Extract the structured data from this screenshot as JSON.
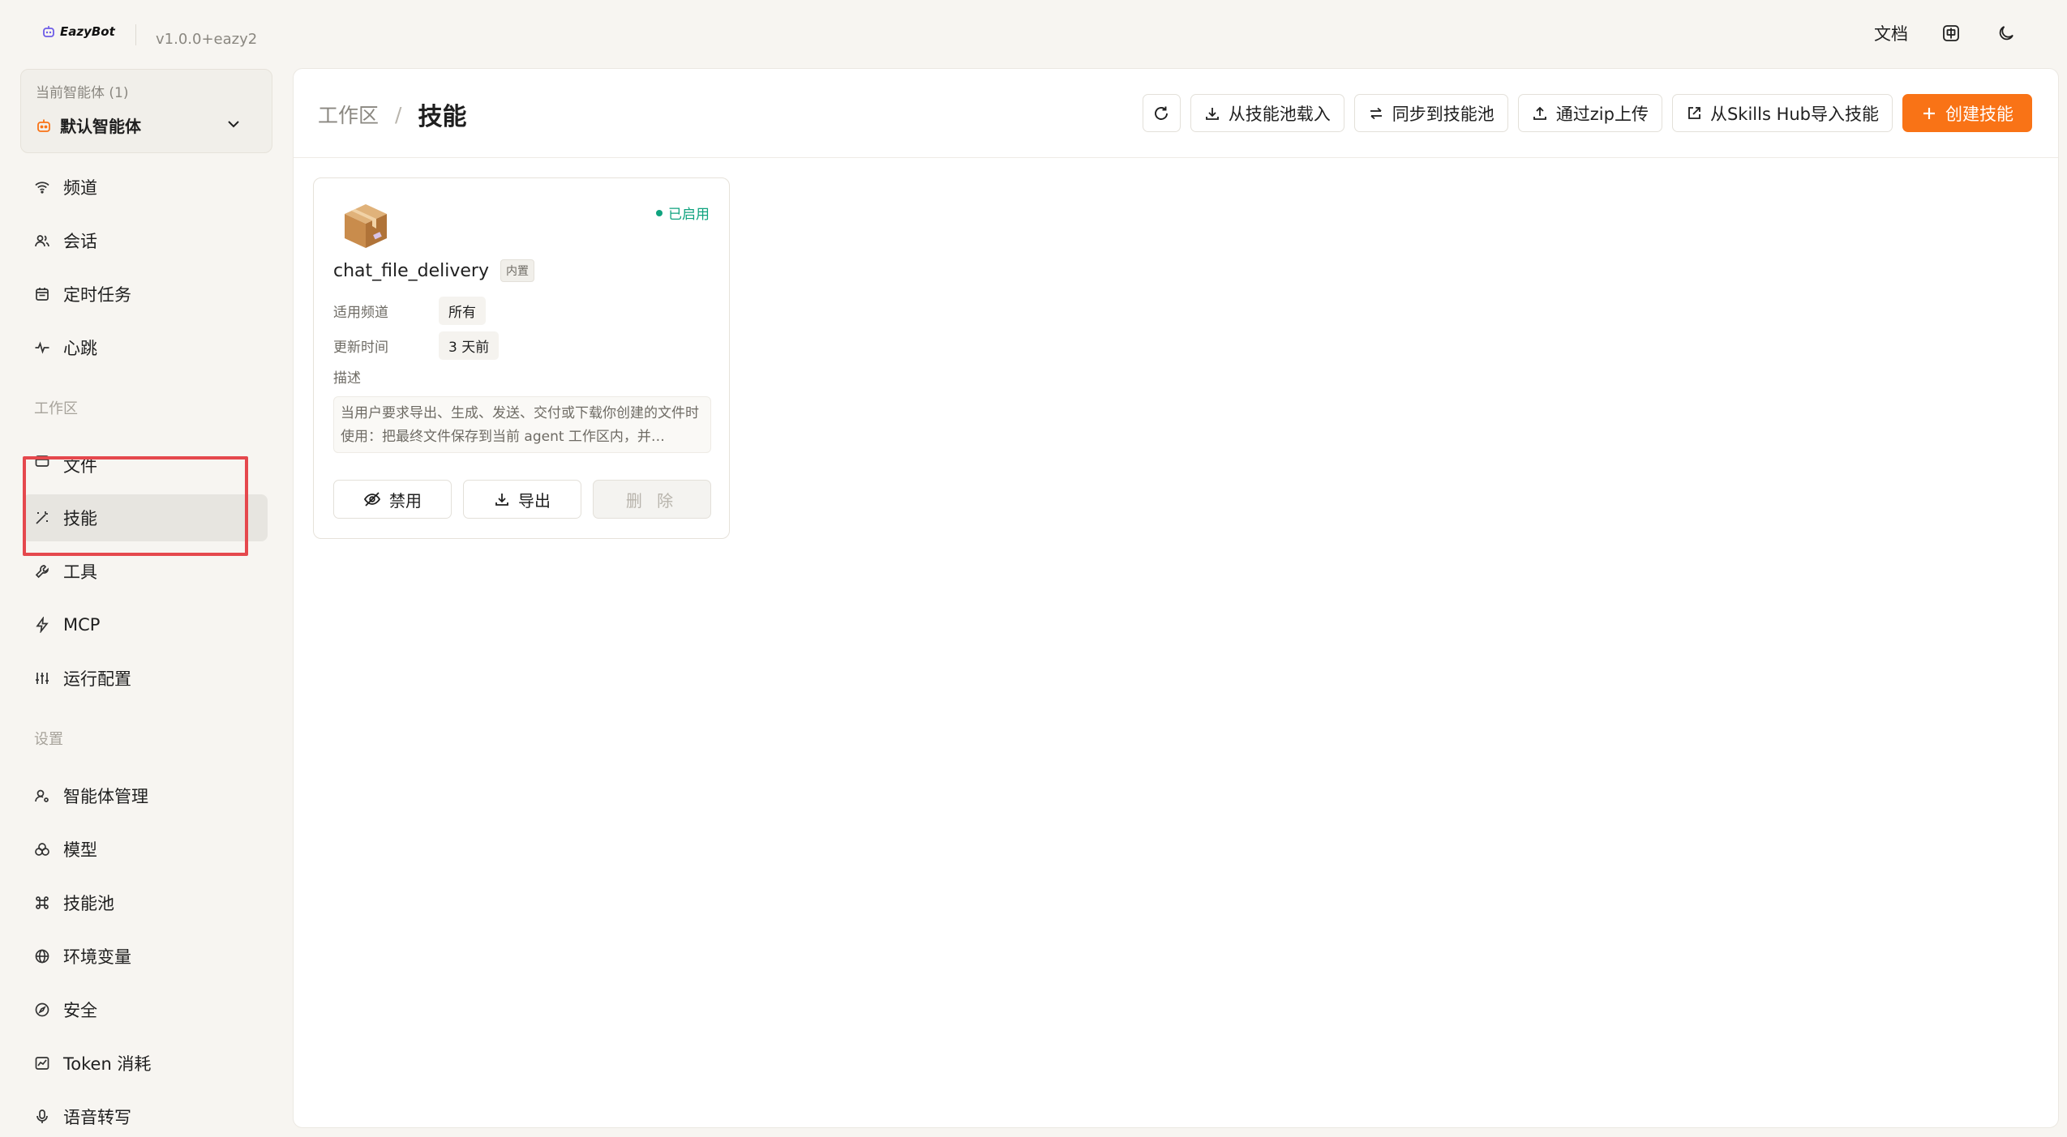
{
  "app": {
    "name": "EazyBot",
    "version": "v1.0.0+eazy2"
  },
  "topbar": {
    "docs_label": "文档"
  },
  "agent_selector": {
    "caption": "当前智能体 (1)",
    "name": "默认智能体"
  },
  "sidebar": {
    "group1": [
      {
        "label": "频道",
        "icon": "wifi-icon"
      },
      {
        "label": "会话",
        "icon": "users-icon"
      },
      {
        "label": "定时任务",
        "icon": "calendar-icon"
      },
      {
        "label": "心跳",
        "icon": "heartbeat-icon"
      }
    ],
    "workspace_label": "工作区",
    "group2": [
      {
        "label": "文件",
        "icon": "folder-icon"
      },
      {
        "label": "技能",
        "icon": "wand-icon",
        "active": true
      },
      {
        "label": "工具",
        "icon": "wrench-icon"
      },
      {
        "label": "MCP",
        "icon": "bolt-icon"
      },
      {
        "label": "运行配置",
        "icon": "sliders-icon"
      }
    ],
    "settings_label": "设置",
    "group3": [
      {
        "label": "智能体管理",
        "icon": "user-cog-icon"
      },
      {
        "label": "模型",
        "icon": "model-icon"
      },
      {
        "label": "技能池",
        "icon": "command-icon"
      },
      {
        "label": "环境变量",
        "icon": "globe-icon"
      },
      {
        "label": "安全",
        "icon": "compass-icon"
      },
      {
        "label": "Token 消耗",
        "icon": "chart-icon"
      },
      {
        "label": "语音转写",
        "icon": "mic-icon"
      }
    ]
  },
  "breadcrumb": {
    "root": "工作区",
    "separator": "/",
    "current": "技能"
  },
  "toolbar": {
    "load_from_pool": "从技能池载入",
    "sync_to_pool": "同步到技能池",
    "upload_zip": "通过zip上传",
    "import_hub": "从Skills Hub导入技能",
    "create_skill": "创建技能"
  },
  "skill": {
    "name": "chat_file_delivery",
    "tag": "内置",
    "status": "已启用",
    "channel_label": "适用频道",
    "channel_value": "所有",
    "updated_label": "更新时间",
    "updated_value": "3 天前",
    "desc_label": "描述",
    "description": "当用户要求导出、生成、发送、交付或下载你创建的文件时使用：把最终文件保存到当前 agent 工作区内，并…",
    "disable_label": "禁用",
    "export_label": "导出",
    "delete_label": "删 除"
  },
  "colors": {
    "accent": "#f97316",
    "enabled": "#10a37f",
    "highlight_box": "#e5484d"
  }
}
